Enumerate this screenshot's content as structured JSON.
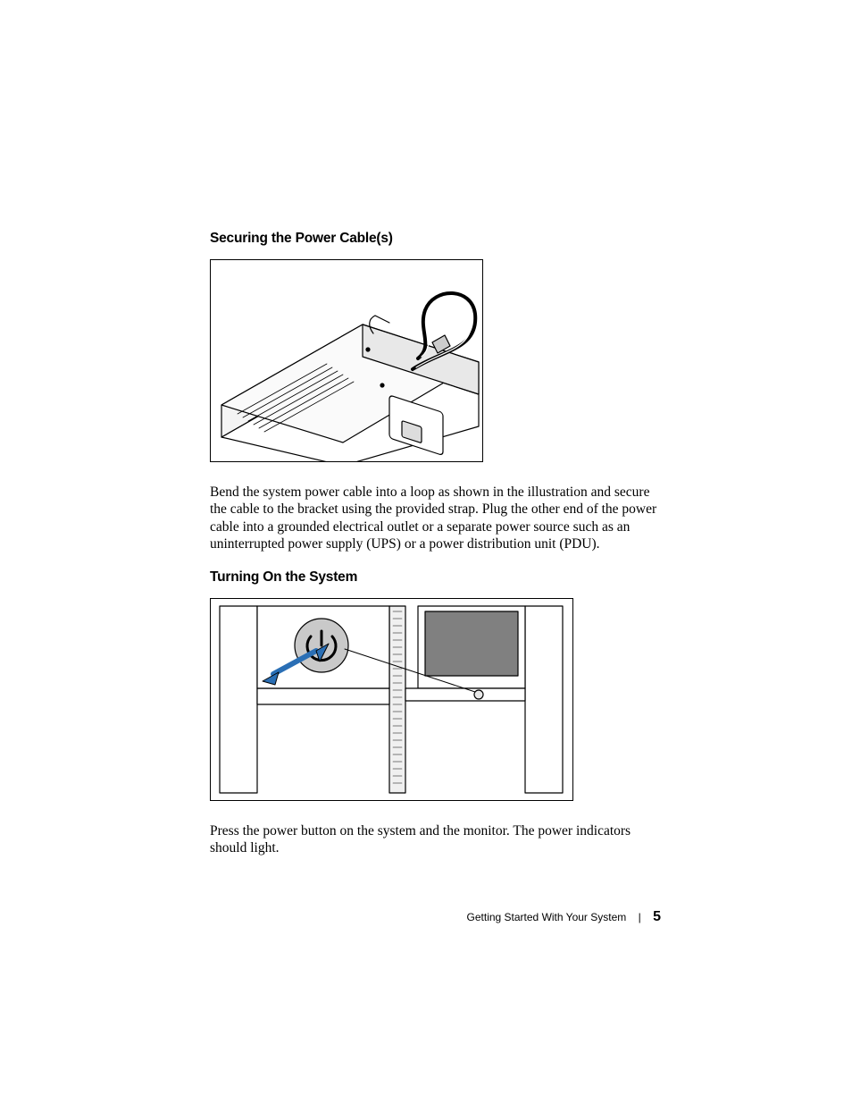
{
  "section1": {
    "heading": "Securing the Power Cable(s)",
    "figure_alt": "Illustration of server power cable secured with retention strap",
    "paragraph": "Bend the system power cable into a loop as shown in the illustration and secure the cable to the bracket using the provided strap. Plug the other end of the power cable into a grounded electrical outlet or a separate power source such as an uninterrupted power supply (UPS) or a power distribution unit (PDU)."
  },
  "section2": {
    "heading": "Turning On the System",
    "figure_alt": "Illustration of pressing the power button on system and monitor",
    "paragraph": "Press the power button on the system and the monitor. The power indicators should light."
  },
  "footer": {
    "doc_title": "Getting Started With Your System",
    "separator": "|",
    "page_number": "5"
  }
}
